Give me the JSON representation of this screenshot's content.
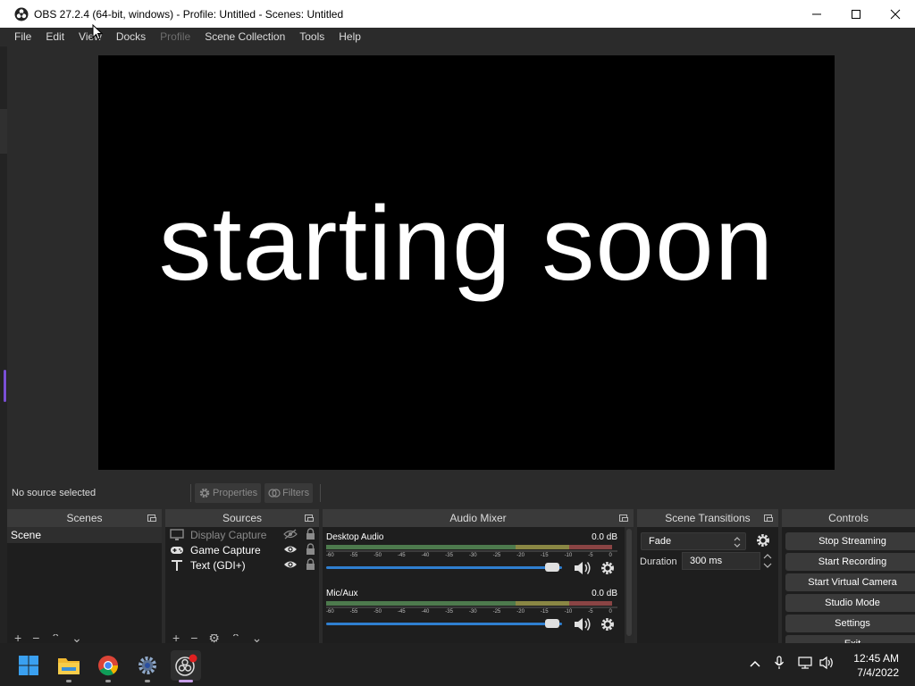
{
  "window": {
    "title": "OBS 27.2.4 (64-bit, windows) - Profile: Untitled - Scenes: Untitled",
    "controls": [
      "minimize",
      "maximize",
      "close"
    ]
  },
  "menu": [
    "File",
    "Edit",
    "View",
    "Docks",
    "Profile",
    "Scene Collection",
    "Tools",
    "Help"
  ],
  "preview": {
    "text": "starting soon"
  },
  "source_toolbar": {
    "status": "No source selected",
    "properties_label": "Properties",
    "filters_label": "Filters"
  },
  "scenes": {
    "title": "Scenes",
    "items": [
      "Scene"
    ]
  },
  "sources": {
    "title": "Sources",
    "items": [
      {
        "name": "Display Capture",
        "icon": "monitor-icon",
        "visible": false,
        "locked": true
      },
      {
        "name": "Game Capture",
        "icon": "gamepad-icon",
        "visible": true,
        "locked": true
      },
      {
        "name": "Text (GDI+)",
        "icon": "text-icon",
        "visible": true,
        "locked": true
      }
    ]
  },
  "audio_mixer": {
    "title": "Audio Mixer",
    "meter_ticks": [
      "-60",
      "-55",
      "-50",
      "-45",
      "-40",
      "-35",
      "-30",
      "-25",
      "-20",
      "-15",
      "-10",
      "-5",
      "0"
    ],
    "channels": [
      {
        "name": "Desktop Audio",
        "level": "0.0 dB",
        "volume_fraction": 0.96
      },
      {
        "name": "Mic/Aux",
        "level": "0.0 dB",
        "volume_fraction": 0.96
      }
    ]
  },
  "scene_transitions": {
    "title": "Scene Transitions",
    "transition": "Fade",
    "duration_label": "Duration",
    "duration_value": "300 ms"
  },
  "controls": {
    "title": "Controls",
    "buttons": [
      "Stop Streaming",
      "Start Recording",
      "Start Virtual Camera",
      "Studio Mode",
      "Settings",
      "Exit"
    ]
  },
  "taskbar": {
    "apps": [
      "windows-start",
      "file-explorer",
      "chrome",
      "settings",
      "obs-studio"
    ],
    "time": "12:45 AM",
    "date": "7/4/2022"
  },
  "colors": {
    "accent_slider": "#2f7fd0",
    "meter_green": "#4d7a4d",
    "meter_yellow": "#8a8744",
    "meter_red": "#8a4444",
    "recording_indicator": "#e02020"
  }
}
